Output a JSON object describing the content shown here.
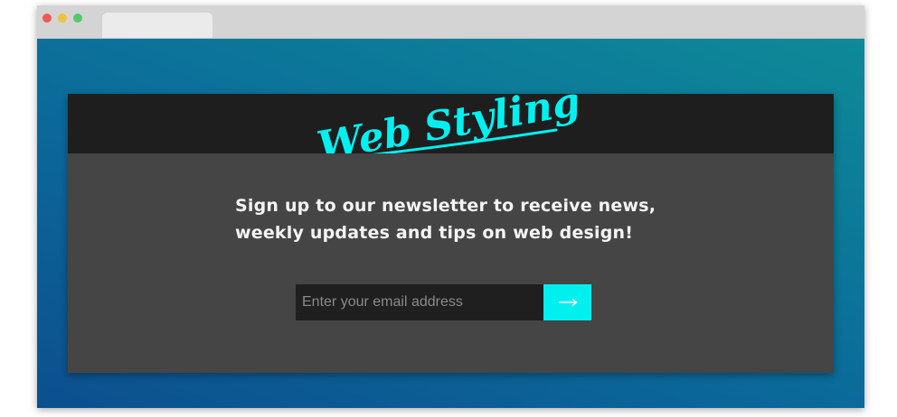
{
  "header": {
    "logo_text": "Web Styling"
  },
  "newsletter": {
    "message_line1": "Sign up to our newsletter to receive news,",
    "message_line2": "weekly updates and tips on web design!",
    "email_placeholder": "Enter your email address",
    "email_value": "",
    "submit_icon": "arrow-right-icon"
  },
  "colors": {
    "accent": "#00f0f0",
    "header_bg": "#1e1e1e",
    "body_bg": "#454545",
    "input_bg": "#1f1f1f",
    "gradient_start": "#0c4f8e",
    "gradient_end": "#0e8a98"
  }
}
